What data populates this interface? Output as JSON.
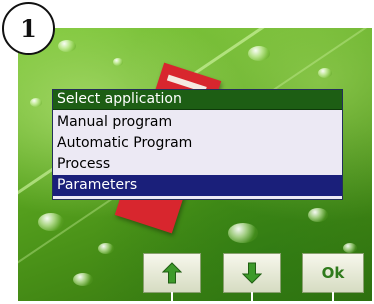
{
  "badge": {
    "number": "1"
  },
  "menu": {
    "title": "Select application",
    "items": [
      {
        "label": "Manual program",
        "selected": false
      },
      {
        "label": "Automatic Program",
        "selected": false
      },
      {
        "label": "Process",
        "selected": false
      },
      {
        "label": "Parameters",
        "selected": true
      }
    ]
  },
  "softkeys": [
    {
      "icon": "arrow-up-icon"
    },
    {
      "icon": "arrow-down-icon"
    },
    {
      "label": "Ok"
    }
  ],
  "colors": {
    "menu_title_bg": "#1d5e14",
    "selection_bg": "#1a1f7a",
    "menu_bg": "#ece9f4",
    "arrow_green": "#3d9a2a"
  }
}
